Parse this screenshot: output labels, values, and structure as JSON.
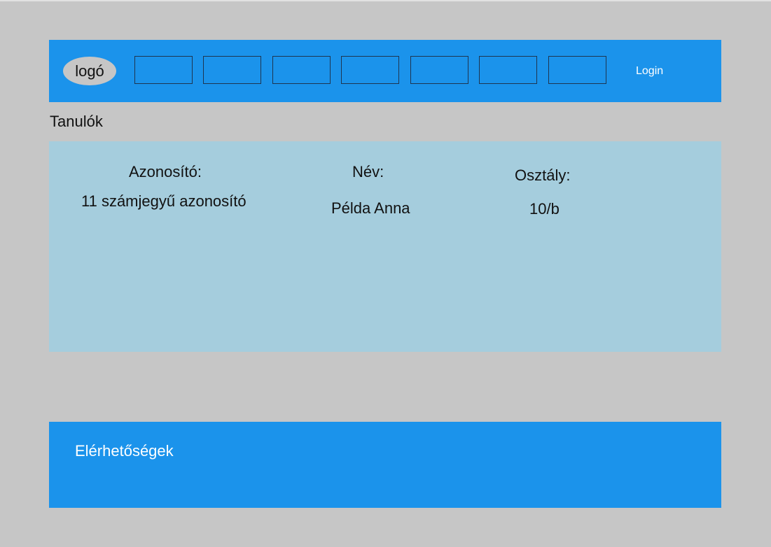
{
  "header": {
    "logo_text": "logó",
    "nav_items": [
      "",
      "",
      "",
      "",
      "",
      "",
      ""
    ],
    "login_label": "Login",
    "background_color": "#1b93eb"
  },
  "page": {
    "title": "Tanulók",
    "background_color": "#c6c6c6"
  },
  "student_panel": {
    "background_color": "#a5cddd",
    "columns": [
      {
        "label": "Azonosító:",
        "value": "11 számjegyű azonosító"
      },
      {
        "label": "Név:",
        "value": "Példa Anna"
      },
      {
        "label": "Osztály:",
        "value": "10/b"
      }
    ]
  },
  "footer": {
    "label": "Elérhetőségek"
  }
}
